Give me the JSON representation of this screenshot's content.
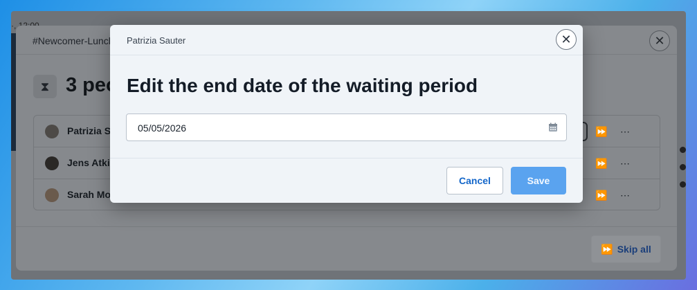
{
  "background": {
    "top_text": "·, 12:00",
    "dialog_title": "#Newcomer-Lunch",
    "heading": "3 peo",
    "people": [
      {
        "name": "Patrizia Sa"
      },
      {
        "name": "Jens Atkin"
      },
      {
        "name": "Sarah Mol"
      }
    ],
    "skip_all_label": "Skip all"
  },
  "modal": {
    "subject": "Patrizia Sauter",
    "heading": "Edit the end date of the waiting period",
    "date_value": "05/05/2026",
    "cancel_label": "Cancel",
    "save_label": "Save"
  },
  "colors": {
    "save_button": "#5aa3ef",
    "cancel_text": "#1366c9"
  },
  "icons": {
    "close": "close-icon",
    "calendar": "calendar-icon",
    "edit": "pencil-icon",
    "skip": "fast-forward-icon",
    "more": "ellipsis-icon",
    "hourglass": "hourglass-icon"
  }
}
